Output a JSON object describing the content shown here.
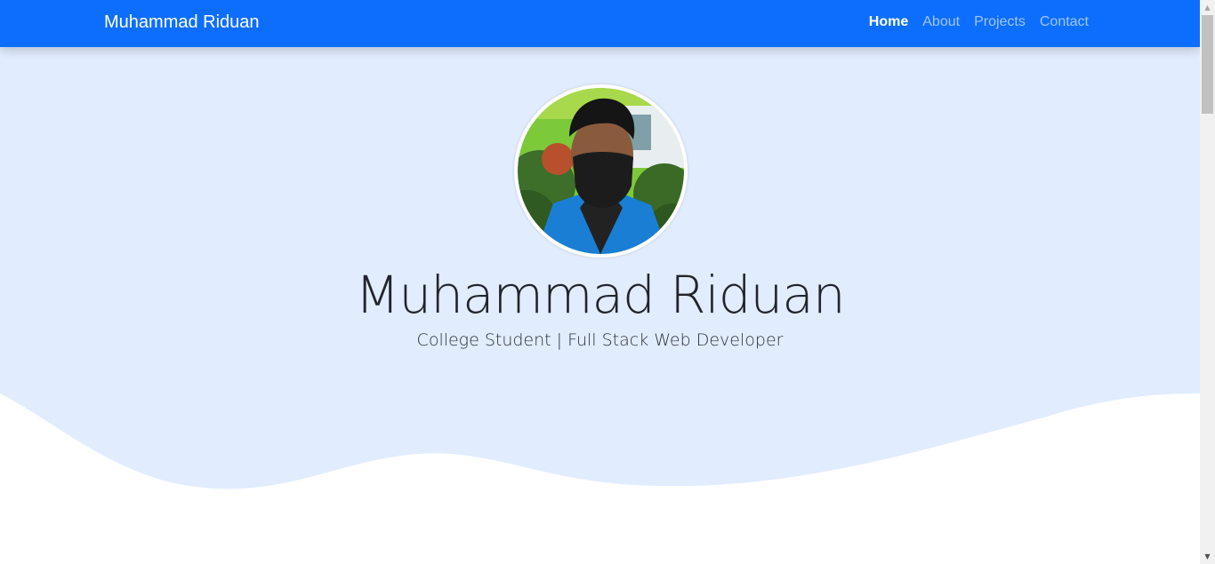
{
  "navbar": {
    "brand": "Muhammad Riduan",
    "links": [
      {
        "label": "Home",
        "active": true
      },
      {
        "label": "About",
        "active": false
      },
      {
        "label": "Projects",
        "active": false
      },
      {
        "label": "Contact",
        "active": false
      }
    ]
  },
  "hero": {
    "name": "Muhammad Riduan",
    "tagline": "College Student | Full Stack Web Developer"
  },
  "colors": {
    "navbar": "#0d6efd",
    "hero_background": "#e1ecfe",
    "page_background": "#ffffff"
  },
  "icons": {
    "scroll_up": "scroll-up-arrow-icon",
    "scroll_down": "scroll-down-arrow-icon"
  }
}
